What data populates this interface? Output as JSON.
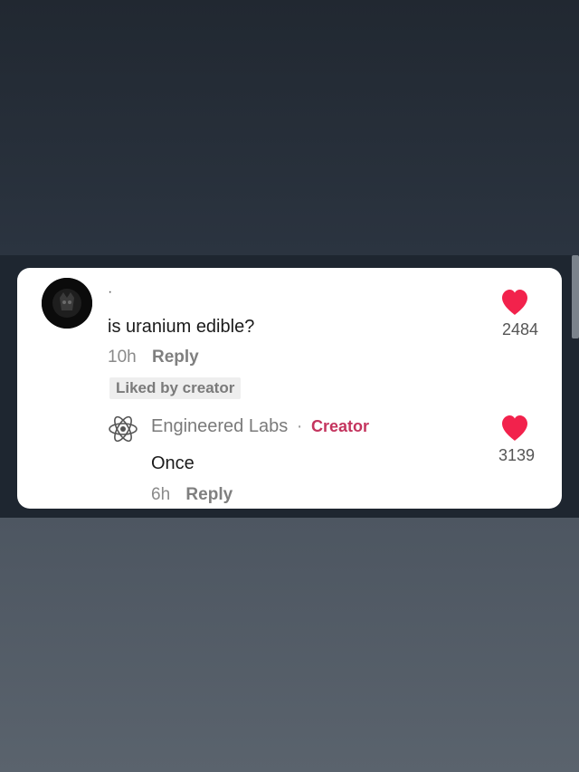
{
  "comment": {
    "username": "·",
    "text": "is uranium edible?",
    "time": "10h",
    "reply_label": "Reply",
    "liked_badge": "Liked by creator",
    "like_count": "2484",
    "like_icon": "heart-icon",
    "avatar_icon": "avatar-image"
  },
  "reply": {
    "author": "Engineered Labs",
    "separator": "·",
    "creator_badge": "Creator",
    "text": "Once",
    "time": "6h",
    "reply_label": "Reply",
    "like_count": "3139",
    "like_icon": "heart-icon",
    "avatar_icon": "atom-icon"
  },
  "colors": {
    "heart": "#f2224c",
    "creator_badge": "#c4345e",
    "card": "#ffffff"
  }
}
